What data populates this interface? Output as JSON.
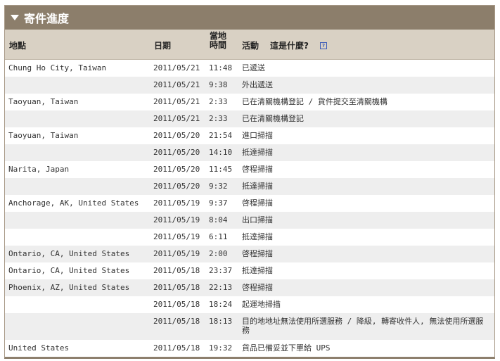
{
  "panel": {
    "title": "寄件進度"
  },
  "columns": {
    "location": "地點",
    "date": "日期",
    "local_time": "當地時間",
    "activity": "活動",
    "what_is_this": "這是什麼?",
    "help_icon": "?"
  },
  "rows": [
    {
      "location": "Chung Ho City, Taiwan",
      "date": "2011/05/21",
      "time": "11:48",
      "activity": "已遞送"
    },
    {
      "location": "",
      "date": "2011/05/21",
      "time": "9:38",
      "activity": "外出遞送"
    },
    {
      "location": "Taoyuan, Taiwan",
      "date": "2011/05/21",
      "time": "2:33",
      "activity": "已在清關機構登記 / 貨件提交至清關機構"
    },
    {
      "location": "",
      "date": "2011/05/21",
      "time": "2:33",
      "activity": "已在清關機構登記"
    },
    {
      "location": "Taoyuan, Taiwan",
      "date": "2011/05/20",
      "time": "21:54",
      "activity": "進口掃描"
    },
    {
      "location": "",
      "date": "2011/05/20",
      "time": "14:10",
      "activity": "抵達掃描"
    },
    {
      "location": "Narita, Japan",
      "date": "2011/05/20",
      "time": "11:45",
      "activity": "啓程掃描"
    },
    {
      "location": "",
      "date": "2011/05/20",
      "time": "9:32",
      "activity": "抵達掃描"
    },
    {
      "location": "Anchorage, AK, United States",
      "date": "2011/05/19",
      "time": "9:37",
      "activity": "啓程掃描"
    },
    {
      "location": "",
      "date": "2011/05/19",
      "time": "8:04",
      "activity": "出口掃描"
    },
    {
      "location": "",
      "date": "2011/05/19",
      "time": "6:11",
      "activity": "抵達掃描"
    },
    {
      "location": "Ontario, CA, United States",
      "date": "2011/05/19",
      "time": "2:00",
      "activity": "啓程掃描"
    },
    {
      "location": "Ontario, CA, United States",
      "date": "2011/05/18",
      "time": "23:37",
      "activity": "抵達掃描"
    },
    {
      "location": "Phoenix, AZ, United States",
      "date": "2011/05/18",
      "time": "22:13",
      "activity": "啓程掃描"
    },
    {
      "location": "",
      "date": "2011/05/18",
      "time": "18:24",
      "activity": "起運地掃描"
    },
    {
      "location": "",
      "date": "2011/05/18",
      "time": "18:13",
      "activity": "目的地地址無法使用所選服務 / 降級, 轉寄收件人, 無法使用所選服務"
    },
    {
      "location": "United States",
      "date": "2011/05/18",
      "time": "19:32",
      "activity": "貨品已備妥並下單給 UPS"
    }
  ]
}
